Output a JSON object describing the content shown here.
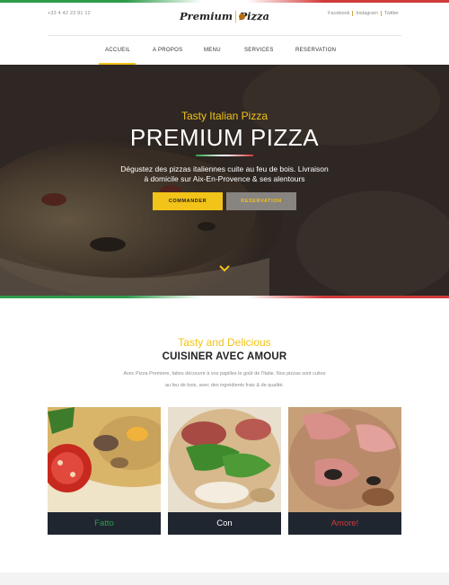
{
  "header": {
    "phone": "+33 4 42 23 91 12",
    "logo_left": "Premium",
    "logo_right": "Pizza",
    "social": [
      "Facebook",
      "Instagram",
      "Twitter"
    ]
  },
  "nav": {
    "items": [
      "ACCUEIL",
      "A PROPOS",
      "MENU",
      "SERVICES",
      "RESERVATION"
    ],
    "active": "ACCUEIL"
  },
  "hero": {
    "subtitle": "Tasty Italian Pizza",
    "title": "PREMIUM PIZZA",
    "description_line1": "Dégustez des pizzas italiennes cuite au feu de bois. Livraison",
    "description_line2": "à domicile sur Aix-En-Provence & ses alentours",
    "btn_order": "COMMANDER",
    "btn_reservation": "RESERVATION"
  },
  "about": {
    "subtitle": "Tasty and Delicious",
    "title": "CUISINER AVEC AMOUR",
    "text_line1": "Avec Pizza Premiere, faites découvrir à vos papilles le goût de l'Italie. Nos pizzas sont cuites",
    "text_line2": "au feu de bois, avec des ingrédients frais & de qualité."
  },
  "cards": [
    {
      "label": "Fatto",
      "color": "#2e9c4a"
    },
    {
      "label": "Con",
      "color": "#ffffff"
    },
    {
      "label": "Amore!",
      "color": "#d23b3b"
    }
  ],
  "colors": {
    "accent": "#f2c318",
    "green": "#2e9c4a",
    "red": "#d23b3b",
    "dark": "#1f2630"
  }
}
